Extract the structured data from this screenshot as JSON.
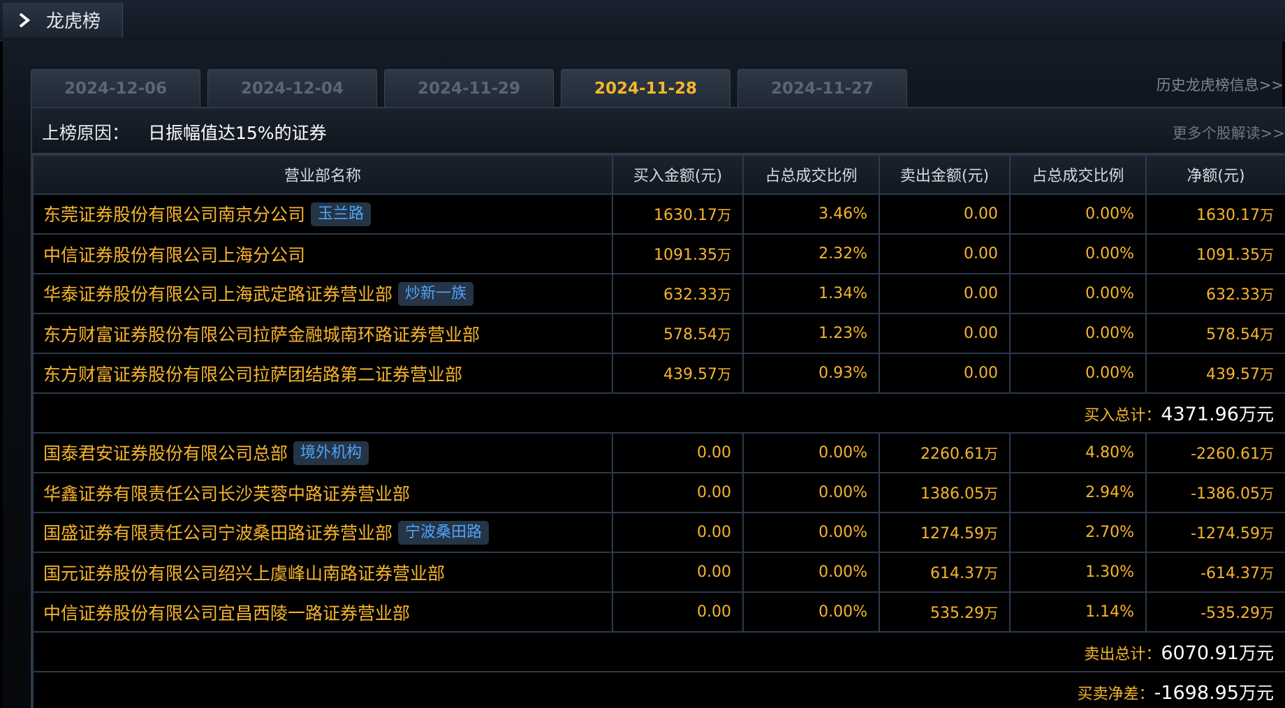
{
  "header": {
    "title": "龙虎榜",
    "icon": "chevron-right-icon"
  },
  "tabs": [
    {
      "label": "2024-12-06",
      "active": false
    },
    {
      "label": "2024-12-04",
      "active": false
    },
    {
      "label": "2024-11-29",
      "active": false
    },
    {
      "label": "2024-11-28",
      "active": true
    },
    {
      "label": "2024-11-27",
      "active": false
    }
  ],
  "history_link": "历史龙虎榜信息>>",
  "reason": {
    "label": "上榜原因：",
    "text": "日振幅值达15%的证券",
    "more_link": "更多个股解读>>"
  },
  "columns": [
    "营业部名称",
    "买入金额(元)",
    "占总成交比例",
    "卖出金额(元)",
    "占总成交比例",
    "净额(元)"
  ],
  "buy_rows": [
    {
      "name": "东莞证券股份有限公司南京分公司",
      "tag": "玉兰路",
      "buy": "1630.17",
      "buy_unit": "万",
      "buy_pct": "3.46%",
      "sell": "0.00",
      "sell_unit": "",
      "sell_pct": "0.00%",
      "net": "1630.17",
      "net_unit": "万"
    },
    {
      "name": "中信证券股份有限公司上海分公司",
      "tag": "",
      "buy": "1091.35",
      "buy_unit": "万",
      "buy_pct": "2.32%",
      "sell": "0.00",
      "sell_unit": "",
      "sell_pct": "0.00%",
      "net": "1091.35",
      "net_unit": "万"
    },
    {
      "name": "华泰证券股份有限公司上海武定路证券营业部",
      "tag": "炒新一族",
      "buy": "632.33",
      "buy_unit": "万",
      "buy_pct": "1.34%",
      "sell": "0.00",
      "sell_unit": "",
      "sell_pct": "0.00%",
      "net": "632.33",
      "net_unit": "万"
    },
    {
      "name": "东方财富证券股份有限公司拉萨金融城南环路证券营业部",
      "tag": "",
      "buy": "578.54",
      "buy_unit": "万",
      "buy_pct": "1.23%",
      "sell": "0.00",
      "sell_unit": "",
      "sell_pct": "0.00%",
      "net": "578.54",
      "net_unit": "万"
    },
    {
      "name": "东方财富证券股份有限公司拉萨团结路第二证券营业部",
      "tag": "",
      "buy": "439.57",
      "buy_unit": "万",
      "buy_pct": "0.93%",
      "sell": "0.00",
      "sell_unit": "",
      "sell_pct": "0.00%",
      "net": "439.57",
      "net_unit": "万"
    }
  ],
  "buy_total": {
    "label": "买入总计：",
    "value": "4371.96",
    "unit": "万元"
  },
  "sell_rows": [
    {
      "name": "国泰君安证券股份有限公司总部",
      "tag": "境外机构",
      "buy": "0.00",
      "buy_unit": "",
      "buy_pct": "0.00%",
      "sell": "2260.61",
      "sell_unit": "万",
      "sell_pct": "4.80%",
      "net": "-2260.61",
      "net_unit": "万"
    },
    {
      "name": "华鑫证券有限责任公司长沙芙蓉中路证券营业部",
      "tag": "",
      "buy": "0.00",
      "buy_unit": "",
      "buy_pct": "0.00%",
      "sell": "1386.05",
      "sell_unit": "万",
      "sell_pct": "2.94%",
      "net": "-1386.05",
      "net_unit": "万"
    },
    {
      "name": "国盛证券有限责任公司宁波桑田路证券营业部",
      "tag": "宁波桑田路",
      "buy": "0.00",
      "buy_unit": "",
      "buy_pct": "0.00%",
      "sell": "1274.59",
      "sell_unit": "万",
      "sell_pct": "2.70%",
      "net": "-1274.59",
      "net_unit": "万"
    },
    {
      "name": "国元证券股份有限公司绍兴上虞峰山南路证券营业部",
      "tag": "",
      "buy": "0.00",
      "buy_unit": "",
      "buy_pct": "0.00%",
      "sell": "614.37",
      "sell_unit": "万",
      "sell_pct": "1.30%",
      "net": "-614.37",
      "net_unit": "万"
    },
    {
      "name": "中信证券股份有限公司宜昌西陵一路证券营业部",
      "tag": "",
      "buy": "0.00",
      "buy_unit": "",
      "buy_pct": "0.00%",
      "sell": "535.29",
      "sell_unit": "万",
      "sell_pct": "1.14%",
      "net": "-535.29",
      "net_unit": "万"
    }
  ],
  "sell_total": {
    "label": "卖出总计：",
    "value": "6070.91",
    "unit": "万元"
  },
  "net_total": {
    "label": "买卖净差：",
    "value": "-1698.95",
    "unit": "万元"
  },
  "colors": {
    "accent": "#f7b52c",
    "tag_text": "#4fa3f7",
    "tag_bg": "#253446",
    "border": "#2c3a4c"
  }
}
